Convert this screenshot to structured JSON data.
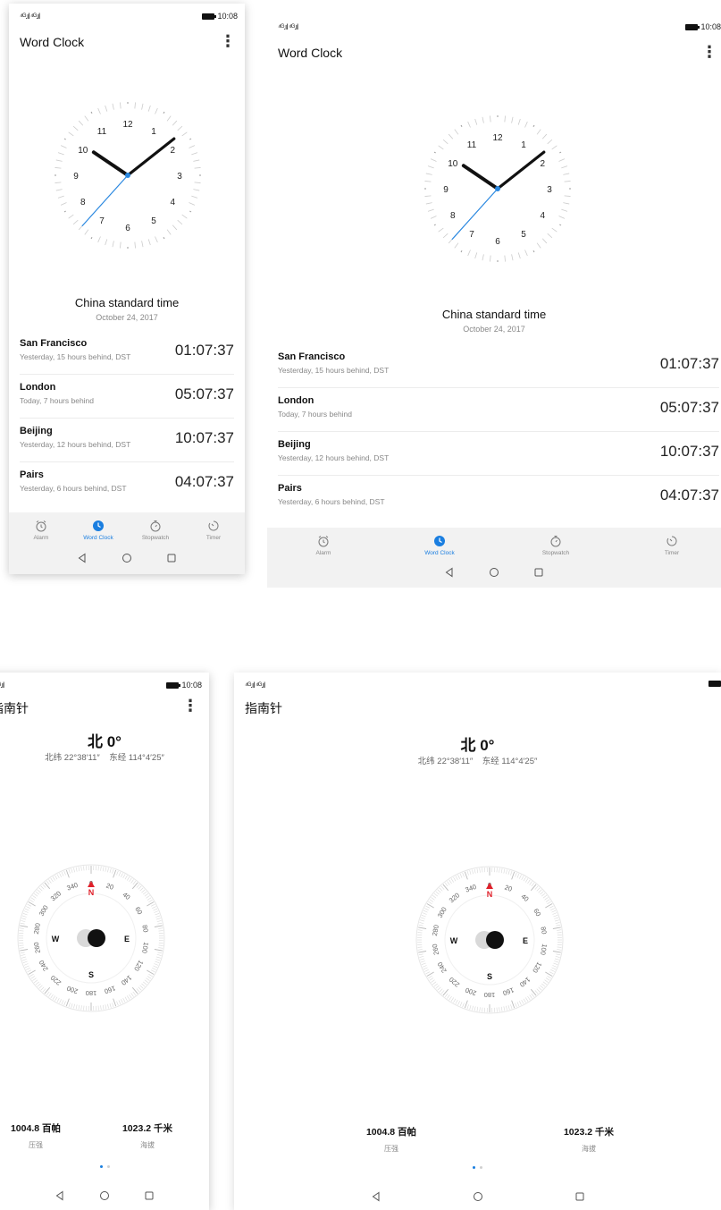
{
  "status": {
    "signal": "⁴ᴳ.ıl ⁴ᴳ.ıl",
    "time": "10:08"
  },
  "clock_app": {
    "title": "Word Clock",
    "menu_icon": "more-vert-icon",
    "clock_numbers": [
      "12",
      "1",
      "2",
      "3",
      "4",
      "5",
      "6",
      "7",
      "8",
      "9",
      "10",
      "11"
    ],
    "clock_time": {
      "hour": 10,
      "minute": 8,
      "second": 37
    },
    "hand_color": "#111111",
    "second_hand_color": "#2a88e0",
    "timezone_title": "China standard time",
    "timezone_date": "October 24, 2017",
    "cities": [
      {
        "name": "San Francisco",
        "desc": "Yesterday, 15 hours behind, DST",
        "time": "01:07:37"
      },
      {
        "name": "London",
        "desc": "Today, 7 hours behind",
        "time": "05:07:37"
      },
      {
        "name": "Beijing",
        "desc": "Yesterday, 12 hours behind, DST",
        "time": "10:07:37"
      },
      {
        "name": "Pairs",
        "desc": "Yesterday, 6 hours behind, DST",
        "time": "04:07:37"
      }
    ],
    "tabs": [
      {
        "label": "Alarm",
        "icon": "alarm-icon",
        "active": false
      },
      {
        "label": "Word Clock",
        "icon": "world-clock-icon",
        "active": true
      },
      {
        "label": "Stopwatch",
        "icon": "stopwatch-icon",
        "active": false
      },
      {
        "label": "Timer",
        "icon": "timer-icon",
        "active": false
      }
    ],
    "accent_color": "#1a7ee0"
  },
  "compass_app": {
    "title": "指南针",
    "menu_icon": "more-vert-icon",
    "heading": "北 0°",
    "coords": "北纬 22°38′11″    东经 114°4′25″",
    "degree_labels": [
      "0",
      "20",
      "40",
      "60",
      "80",
      "100",
      "120",
      "140",
      "160",
      "180",
      "200",
      "220",
      "240",
      "260",
      "280",
      "300",
      "320",
      "340"
    ],
    "cardinals": {
      "n": "N",
      "e": "E",
      "s": "S",
      "w": "W"
    },
    "north_color": "#e0202a",
    "pressure_value": "1004.8 百帕",
    "pressure_label": "压强",
    "altitude_value": "1023.2 千米",
    "altitude_label": "海拔",
    "page_dots": 2,
    "active_dot": 0
  },
  "system_nav": [
    "back-icon",
    "home-icon",
    "recents-icon"
  ]
}
